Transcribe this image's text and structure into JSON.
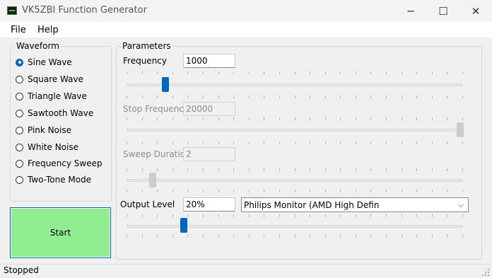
{
  "window": {
    "title": "VK5ZBI Function Generator",
    "minimize_glyph": "─",
    "maximize_glyph": "☐",
    "close_glyph": "✕",
    "icon": "function-generator-icon"
  },
  "menu": {
    "items": [
      {
        "label": "File"
      },
      {
        "label": "Help"
      }
    ]
  },
  "waveform": {
    "title": "Waveform",
    "selected": "Sine Wave",
    "options": [
      {
        "label": "Sine Wave",
        "checked": true
      },
      {
        "label": "Square Wave",
        "checked": false
      },
      {
        "label": "Triangle Wave",
        "checked": false
      },
      {
        "label": "Sawtooth Wave",
        "checked": false
      },
      {
        "label": "Pink Noise",
        "checked": false
      },
      {
        "label": "White Noise",
        "checked": false
      },
      {
        "label": "Frequency Sweep",
        "checked": false
      },
      {
        "label": "Two-Tone Mode",
        "checked": false
      }
    ]
  },
  "start_button": {
    "label": "Start",
    "color": "#90ee90"
  },
  "parameters": {
    "title": "Parameters",
    "frequency": {
      "label": "Frequency",
      "value": "1000",
      "slider_position": 0.06,
      "enabled": true
    },
    "stop_frequency": {
      "label": "Stop Frequency",
      "value": "20000",
      "slider_position": 1.0,
      "enabled": false
    },
    "sweep_duration": {
      "label": "Sweep Duration",
      "value": "2",
      "slider_position": 0.02,
      "enabled": false
    },
    "output_level": {
      "label": "Output Level",
      "value": "20%",
      "slider_position": 0.12,
      "enabled": true
    },
    "output_device": {
      "selected": "Philips Monitor (AMD High Defin"
    }
  },
  "status": {
    "text": "Stopped"
  },
  "colors": {
    "accent": "#0067c0",
    "start_button": "#90ee90",
    "disabled_text": "#8d8d8d"
  }
}
